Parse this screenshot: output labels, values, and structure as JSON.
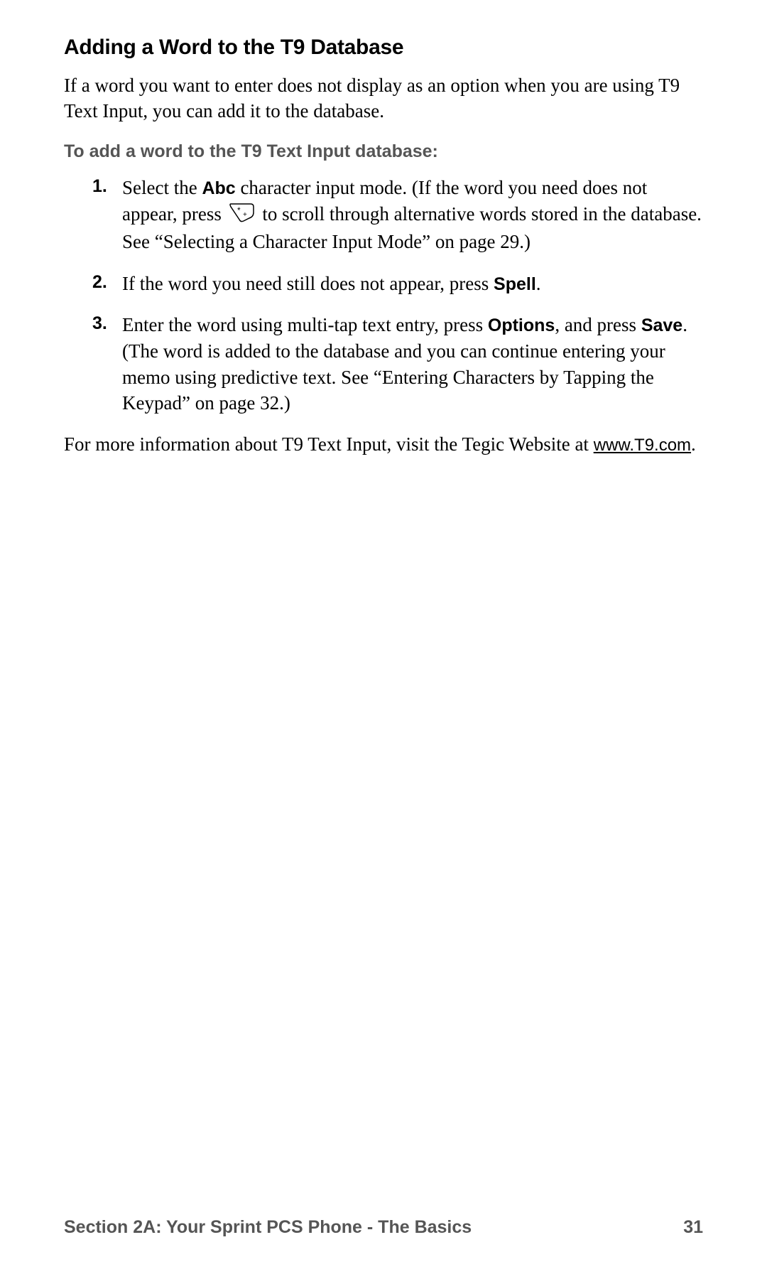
{
  "heading": "Adding a Word to the T9 Database",
  "intro": "If a word you want to enter does not display as an option when you are using T9 Text Input, you can add it to the database.",
  "subheading": "To add a word to the T9 Text Input database:",
  "steps": [
    {
      "num": "1.",
      "pre": "Select the ",
      "bold1": "Abc",
      "mid1": " character input mode. (If the word you need does not appear, press ",
      "iconName": "star-key-icon",
      "post": " to scroll through alternative words stored in the database. See “Selecting a Character Input Mode” on page 29.)"
    },
    {
      "num": "2.",
      "pre": "If the word you need still does not appear, press ",
      "bold1": "Spell",
      "post": "."
    },
    {
      "num": "3.",
      "pre": "Enter the word using multi-tap text entry, press ",
      "bold1": "Options",
      "mid1": ", and press ",
      "bold2": "Save",
      "post": ". (The word is added to the database and you can continue entering your memo using predictive text. See “Entering Characters by Tapping the Keypad” on page 32.)"
    }
  ],
  "more": {
    "pre": "For more information about T9 Text Input, visit the Tegic Website at ",
    "link": "www.T9.com",
    "post": "."
  },
  "footer": {
    "section": "Section 2A: Your Sprint PCS Phone - The Basics",
    "page": "31"
  }
}
